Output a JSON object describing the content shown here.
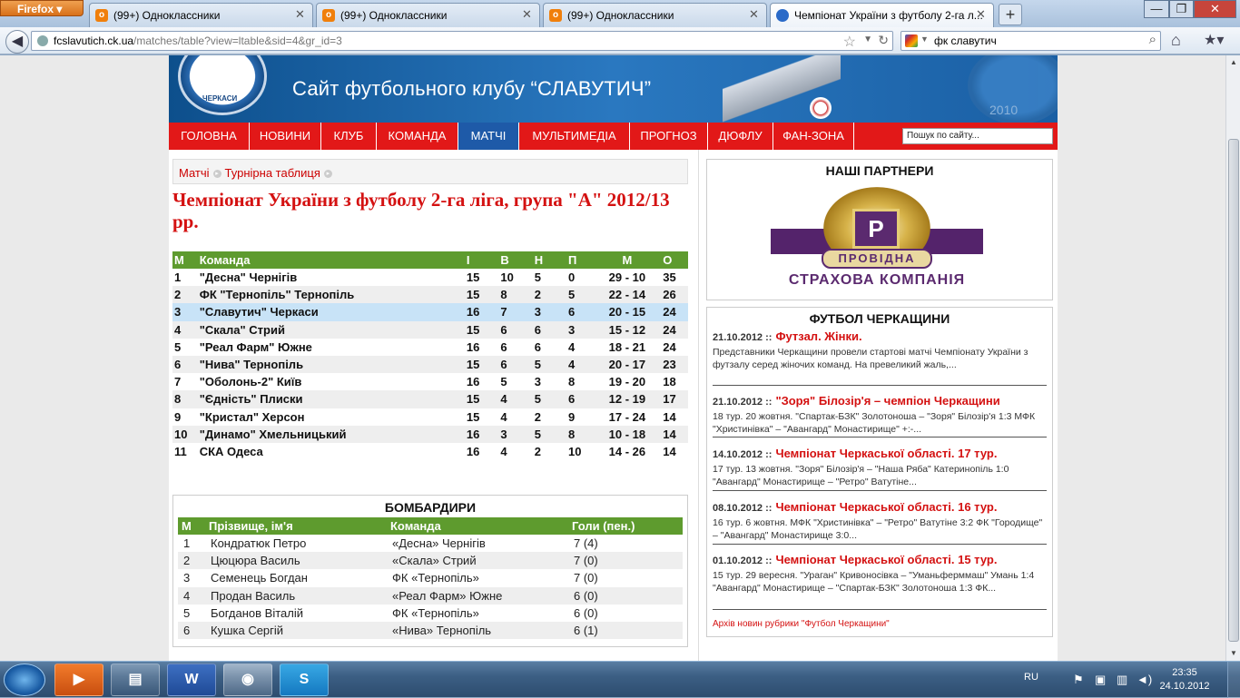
{
  "browser": {
    "menu_button": "Firefox",
    "tabs": [
      {
        "label": "(99+) Одноклассники",
        "icon": "ok-icon"
      },
      {
        "label": "(99+) Одноклассники",
        "icon": "ok-icon"
      },
      {
        "label": "(99+) Одноклассники",
        "icon": "ok-icon"
      },
      {
        "label": "Чемпіонат України з футболу 2-га л...",
        "icon": "club-icon",
        "active": true
      }
    ],
    "url_host": "fcslavutich.ck.ua",
    "url_path": "/matches/table?view=ltable&sid=4&gr_id=3",
    "search_value": "фк славутич",
    "window_controls": {
      "minimize": "—",
      "maximize": "❐",
      "close": "✕"
    }
  },
  "site": {
    "slogan": "Сайт футбольного клубу “СЛАВУТИЧ”",
    "crest_text": "ЧЕРКАСИ",
    "crest2_text": "2010",
    "nav": [
      "ГОЛОВНА",
      "НОВИНИ",
      "КЛУБ",
      "КОМАНДА",
      "МАТЧІ",
      "МУЛЬТИМЕДІА",
      "ПРОГНОЗ",
      "ДЮФЛУ",
      "ФАН-ЗОНА"
    ],
    "nav_active": "МАТЧІ",
    "search_placeholder": "Пошук по сайту..."
  },
  "breadcrumb": [
    "Матчі",
    "Турнірна таблиця"
  ],
  "page_title": "Чемпіонат України з футболу 2-га ліга, група \"А\" 2012/13 рр.",
  "standings": {
    "headers": [
      "М",
      "Команда",
      "І",
      "В",
      "Н",
      "П",
      "М",
      "О"
    ],
    "highlight_row": 3,
    "rows": [
      [
        "1",
        "\"Десна\" Чернігів",
        "15",
        "10",
        "5",
        "0",
        "29 - 10",
        "35"
      ],
      [
        "2",
        "ФК \"Тернопіль\" Тернопіль",
        "15",
        "8",
        "2",
        "5",
        "22 - 14",
        "26"
      ],
      [
        "3",
        "\"Славутич\" Черкаси",
        "16",
        "7",
        "3",
        "6",
        "20 - 15",
        "24"
      ],
      [
        "4",
        "\"Скала\" Стрий",
        "15",
        "6",
        "6",
        "3",
        "15 - 12",
        "24"
      ],
      [
        "5",
        "\"Реал Фарм\" Южне",
        "16",
        "6",
        "6",
        "4",
        "18 - 21",
        "24"
      ],
      [
        "6",
        "\"Нива\" Тернопіль",
        "15",
        "6",
        "5",
        "4",
        "20 - 17",
        "23"
      ],
      [
        "7",
        "\"Оболонь-2\" Київ",
        "16",
        "5",
        "3",
        "8",
        "19 - 20",
        "18"
      ],
      [
        "8",
        "\"Єдність\" Плиски",
        "15",
        "4",
        "5",
        "6",
        "12 - 19",
        "17"
      ],
      [
        "9",
        "\"Кристал\" Херсон",
        "15",
        "4",
        "2",
        "9",
        "17 - 24",
        "14"
      ],
      [
        "10",
        "\"Динамо\" Хмельницький",
        "16",
        "3",
        "5",
        "8",
        "10 - 18",
        "14"
      ],
      [
        "11",
        "СКА Одеса",
        "16",
        "4",
        "2",
        "10",
        "14 - 26",
        "14"
      ]
    ]
  },
  "scorers": {
    "title": "БОМБАРДИРИ",
    "headers": [
      "М",
      "Прізвище, ім'я",
      "Команда",
      "Голи (пен.)"
    ],
    "rows": [
      [
        "1",
        "Кондратюк Петро",
        "«Десна» Чернігів",
        "7 (4)"
      ],
      [
        "2",
        "Цюцюра Василь",
        "«Скала» Стрий",
        "7 (0)"
      ],
      [
        "3",
        "Семенець Богдан",
        "ФК «Тернопіль»",
        "7 (0)"
      ],
      [
        "4",
        "Продан Василь",
        "«Реал Фарм» Южне",
        "6 (0)"
      ],
      [
        "5",
        "Богданов Віталій",
        "ФК «Тернопіль»",
        "6 (0)"
      ],
      [
        "6",
        "Кушка Сергій",
        "«Нива» Тернопіль",
        "6 (1)"
      ]
    ]
  },
  "partners": {
    "title": "НАШІ ПАРТНЕРИ",
    "logo_letter": "Р",
    "logo_word": "ПРОВІДНА",
    "logo_caption": "СТРАХОВА КОМПАНІЯ"
  },
  "news": {
    "title": "ФУТБОЛ ЧЕРКАЩИНИ",
    "items": [
      {
        "date": "21.10.2012 ::",
        "title": "Футзал. Жінки.",
        "text": "Представники Черкащини провели стартові матчі Чемпіонату України з футзалу серед жіночих команд. На превеликий жаль,..."
      },
      {
        "date": "21.10.2012 ::",
        "title": "\"Зоря\" Білозір'я – чемпіон Черкащини",
        "text": "18 тур. 20 жовтня. \"Спартак-БЗК\" Золотоноша – \"Зоря\" Білозір'я 1:3 МФК \"Христинівка\" –  \"Авангард\" Монастирище\" +:-..."
      },
      {
        "date": "14.10.2012 ::",
        "title": "Чемпіонат Черкаської області. 17 тур.",
        "text": "17 тур. 13 жовтня. \"Зоря\" Білозір'я – \"Наша Ряба\" Катеринопіль 1:0 \"Авангард\" Монастирище – \"Ретро\" Ватутіне..."
      },
      {
        "date": "08.10.2012 ::",
        "title": "Чемпіонат Черкаської області. 16 тур.",
        "text": "16 тур. 6 жовтня. МФК \"Христинівка\" – \"Ретро\" Ватутіне 3:2 ФК \"Городище\" – \"Авангард\" Монастирище 3:0..."
      },
      {
        "date": "01.10.2012 ::",
        "title": "Чемпіонат Черкаської області. 15 тур.",
        "text": "15 тур. 29 вересня. \"Ураган\" Кривоносівка – \"Уманьферммаш\" Умань 1:4 \"Авангард\" Монастирище – \"Спартак-БЗК\" Золотоноша 1:3 ФК..."
      }
    ],
    "archive_link": "Архів новин рубрики \"Футбол Черкащини\""
  },
  "taskbar": {
    "language": "RU",
    "time": "23:35",
    "date": "24.10.2012",
    "apps": [
      "media-player-icon",
      "explorer-icon",
      "word-icon",
      "firefox-icon",
      "skype-icon"
    ]
  },
  "colors": {
    "nav_red": "#e21818",
    "nav_active_blue": "#1e5aa8",
    "table_header_green": "#5e9b2e",
    "title_red": "#d41111",
    "highlight_blue": "#c8e3f7"
  }
}
